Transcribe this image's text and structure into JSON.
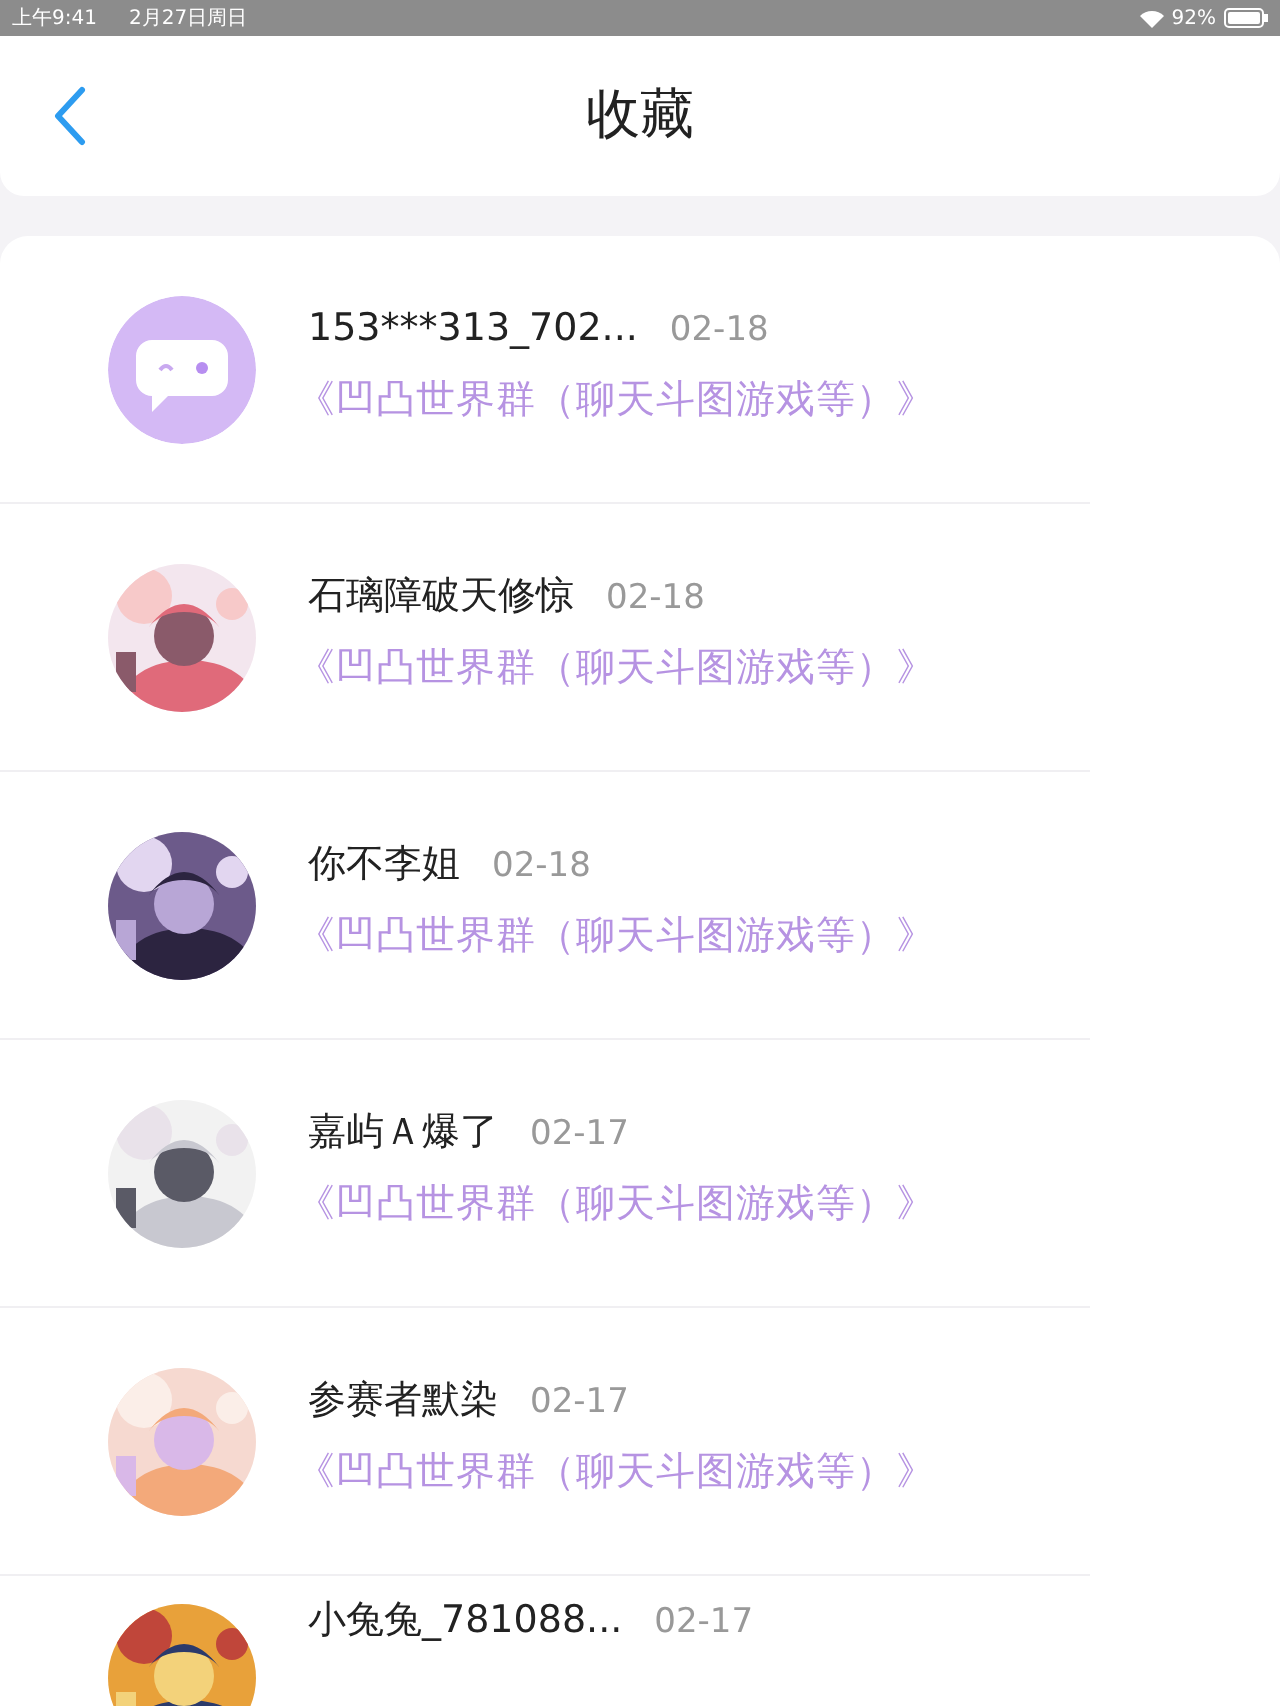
{
  "status_bar": {
    "time": "上午9:41",
    "date": "2月27日周日",
    "battery": "92%"
  },
  "header": {
    "title": "收藏"
  },
  "items": [
    {
      "name": "153***313_702...",
      "date": "02-18",
      "group": "《凹凸世界群（聊天斗图游戏等）》",
      "avatar": {
        "kind": "default"
      }
    },
    {
      "name": "石璃障破天修惊",
      "date": "02-18",
      "group": "《凹凸世界群（聊天斗图游戏等）》"
    },
    {
      "name": "你不李姐",
      "date": "02-18",
      "group": "《凹凸世界群（聊天斗图游戏等）》"
    },
    {
      "name": "嘉屿Ａ爆了",
      "date": "02-17",
      "group": "《凹凸世界群（聊天斗图游戏等）》"
    },
    {
      "name": "参赛者默染",
      "date": "02-17",
      "group": "《凹凸世界群（聊天斗图游戏等）》"
    },
    {
      "name": "小兔兔_781088...",
      "date": "02-17"
    }
  ]
}
